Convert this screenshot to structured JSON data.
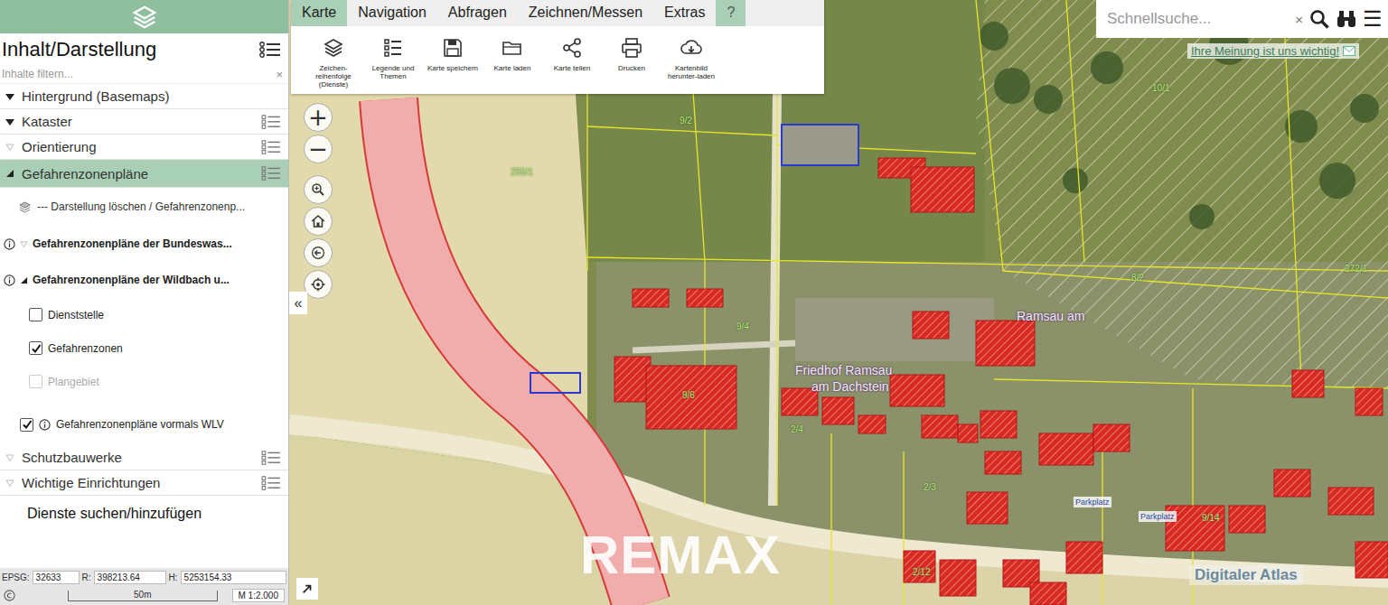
{
  "sidebar": {
    "title": "Inhalt/Darstellung",
    "filter": {
      "placeholder": "Inhalte filtern...",
      "clear": "×"
    },
    "items": [
      {
        "kind": "group",
        "label": "Hintergrund (Basemaps)",
        "expanded": false,
        "active": true,
        "selected": false,
        "legend": false
      },
      {
        "kind": "group",
        "label": "Kataster",
        "expanded": false,
        "active": true,
        "selected": false,
        "legend": true
      },
      {
        "kind": "group",
        "label": "Orientierung",
        "expanded": false,
        "active": false,
        "selected": false,
        "legend": true
      },
      {
        "kind": "group",
        "label": "Gefahrenzonenpläne",
        "expanded": true,
        "active": true,
        "selected": true,
        "legend": true
      },
      {
        "kind": "action",
        "label": "--- Darstellung löschen / Gefahrenzonenp..."
      },
      {
        "kind": "subgroup",
        "label": "Gefahrenzonenpläne der Bundeswas...",
        "expanded": false,
        "active": false,
        "info": true
      },
      {
        "kind": "subgroup",
        "label": "Gefahrenzonenpläne der Wildbach u...",
        "expanded": true,
        "active": true,
        "info": true
      },
      {
        "kind": "checkbox",
        "label": "Dienststelle",
        "checked": false,
        "disabled": false,
        "info": false,
        "nested": true
      },
      {
        "kind": "checkbox",
        "label": "Gefahrenzonen",
        "checked": true,
        "disabled": false,
        "info": false,
        "nested": true
      },
      {
        "kind": "checkbox",
        "label": "Plangebiet",
        "checked": false,
        "disabled": true,
        "info": false,
        "nested": true
      },
      {
        "kind": "checkbox",
        "label": "Gefahrenzonenpläne vormals WLV",
        "checked": true,
        "disabled": false,
        "info": true,
        "nested": false
      },
      {
        "kind": "group",
        "label": "Schutzbauwerke",
        "expanded": false,
        "active": false,
        "selected": false,
        "legend": true
      },
      {
        "kind": "group",
        "label": "Wichtige Einrichtungen",
        "expanded": false,
        "active": false,
        "selected": false,
        "legend": true
      },
      {
        "kind": "link",
        "label": "Dienste suchen/hinzufügen"
      }
    ],
    "footer": {
      "epsg_label": "EPSG:",
      "epsg": "32633",
      "r_label": "R:",
      "r": "398213.64",
      "h_label": "H:",
      "h": "5253154.33",
      "scale_bar": "50m",
      "scale": "M 1:2.000"
    },
    "collapse": "«"
  },
  "toolbar": {
    "tabs": [
      {
        "label": "Karte",
        "selected": true,
        "accent": false
      },
      {
        "label": "Navigation",
        "selected": false,
        "accent": false
      },
      {
        "label": "Abfragen",
        "selected": false,
        "accent": false
      },
      {
        "label": "Zeichnen/Messen",
        "selected": false,
        "accent": false
      },
      {
        "label": "Extras",
        "selected": false,
        "accent": false
      },
      {
        "label": "?",
        "selected": false,
        "accent": true
      }
    ],
    "buttons": [
      {
        "label": "Zeichen-reihenfolge (Dienste)",
        "icon": "layers"
      },
      {
        "label": "Legende und Themen",
        "icon": "legend"
      },
      {
        "label": "Karte speichern",
        "icon": "save"
      },
      {
        "label": "Karte laden",
        "icon": "folder"
      },
      {
        "label": "Karte teilen",
        "icon": "share"
      },
      {
        "label": "Drucken",
        "icon": "print"
      },
      {
        "label": "Kartenbild herunter-laden",
        "icon": "download"
      }
    ]
  },
  "search": {
    "placeholder": "Schnellsuche...",
    "clear": "×",
    "menu": "☰"
  },
  "feedback": "Ihre Meinung ist uns wichtig!",
  "zoom": {
    "in": "+",
    "out": "−"
  },
  "map_labels": [
    {
      "text": "10/1",
      "kind": "parcel"
    },
    {
      "text": "9/2",
      "kind": "parcel"
    },
    {
      "text": "8/2",
      "kind": "parcel"
    },
    {
      "text": "272/1",
      "kind": "parcel"
    },
    {
      "text": "255/1",
      "kind": "parcel"
    },
    {
      "text": "9/6",
      "kind": "parcel"
    },
    {
      "text": "9/4",
      "kind": "parcel"
    },
    {
      "text": "2/4",
      "kind": "parcel"
    },
    {
      "text": "2/3",
      "kind": "parcel"
    },
    {
      "text": "2/12",
      "kind": "parcel"
    },
    {
      "text": "9/14",
      "kind": "parcel"
    },
    {
      "text": "Ramsau am",
      "kind": "place"
    },
    {
      "text": "Friedhof Ramsau",
      "kind": "place"
    },
    {
      "text": "am Dachstein",
      "kind": "place"
    },
    {
      "text": "Parkplatz",
      "kind": "poi"
    },
    {
      "text": "Parkplatz",
      "kind": "poi"
    }
  ],
  "watermark": "REMAX",
  "brand": "Digitaler Atlas"
}
